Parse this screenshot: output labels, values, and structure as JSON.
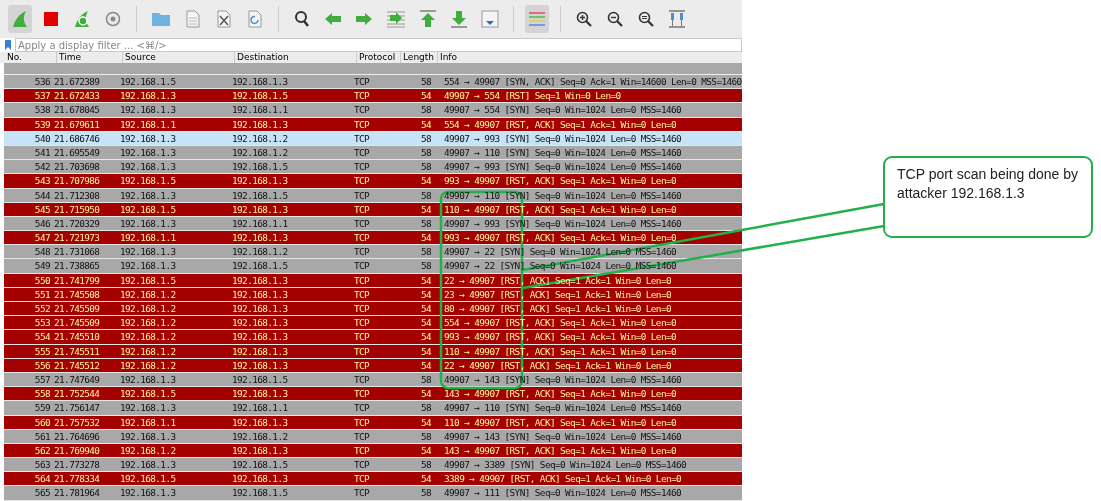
{
  "filter_bar": {
    "placeholder": "Apply a display filter ... <⌘/>"
  },
  "columns": [
    "No.",
    "Time",
    "Source",
    "Destination",
    "Protocol",
    "Length",
    "Info"
  ],
  "rows": [
    {
      "kind": "syn",
      "selected": false,
      "cells": [
        "536",
        "21.672389",
        "192.168.1.5",
        "192.168.1.3",
        "TCP",
        "58",
        "554 → 49907 [SYN, ACK] Seq=0 Ack=1 Win=14600 Len=0 MSS=1460"
      ]
    },
    {
      "kind": "rst",
      "selected": false,
      "cells": [
        "537",
        "21.672433",
        "192.168.1.3",
        "192.168.1.5",
        "TCP",
        "54",
        "49907 → 554 [RST] Seq=1 Win=0 Len=0"
      ]
    },
    {
      "kind": "syn",
      "selected": false,
      "cells": [
        "538",
        "21.678045",
        "192.168.1.3",
        "192.168.1.1",
        "TCP",
        "58",
        "49907 → 554 [SYN] Seq=0 Win=1024 Len=0 MSS=1460"
      ]
    },
    {
      "kind": "rst",
      "selected": false,
      "cells": [
        "539",
        "21.679611",
        "192.168.1.1",
        "192.168.1.3",
        "TCP",
        "54",
        "554 → 49907 [RST, ACK] Seq=1 Ack=1 Win=0 Len=0"
      ]
    },
    {
      "kind": "syn",
      "selected": true,
      "cells": [
        "540",
        "21.686746",
        "192.168.1.3",
        "192.168.1.2",
        "TCP",
        "58",
        "49907 → 993 [SYN] Seq=0 Win=1024 Len=0 MSS=1460"
      ]
    },
    {
      "kind": "syn",
      "selected": false,
      "cells": [
        "541",
        "21.695549",
        "192.168.1.3",
        "192.168.1.2",
        "TCP",
        "58",
        "49907 → 110 [SYN] Seq=0 Win=1024 Len=0 MSS=1460"
      ]
    },
    {
      "kind": "syn",
      "selected": false,
      "cells": [
        "542",
        "21.703698",
        "192.168.1.3",
        "192.168.1.5",
        "TCP",
        "58",
        "49907 → 993 [SYN] Seq=0 Win=1024 Len=0 MSS=1460"
      ]
    },
    {
      "kind": "rst",
      "selected": false,
      "cells": [
        "543",
        "21.707986",
        "192.168.1.5",
        "192.168.1.3",
        "TCP",
        "54",
        "993 → 49907 [RST, ACK] Seq=1 Ack=1 Win=0 Len=0"
      ]
    },
    {
      "kind": "syn",
      "selected": false,
      "cells": [
        "544",
        "21.712308",
        "192.168.1.3",
        "192.168.1.5",
        "TCP",
        "58",
        "49907 → 110 [SYN] Seq=0 Win=1024 Len=0 MSS=1460"
      ]
    },
    {
      "kind": "rst",
      "selected": false,
      "cells": [
        "545",
        "21.715950",
        "192.168.1.5",
        "192.168.1.3",
        "TCP",
        "54",
        "110 → 49907 [RST, ACK] Seq=1 Ack=1 Win=0 Len=0"
      ]
    },
    {
      "kind": "syn",
      "selected": false,
      "cells": [
        "546",
        "21.720329",
        "192.168.1.3",
        "192.168.1.1",
        "TCP",
        "58",
        "49907 → 993 [SYN] Seq=0 Win=1024 Len=0 MSS=1460"
      ]
    },
    {
      "kind": "rst",
      "selected": false,
      "cells": [
        "547",
        "21.721973",
        "192.168.1.1",
        "192.168.1.3",
        "TCP",
        "54",
        "993 → 49907 [RST, ACK] Seq=1 Ack=1 Win=0 Len=0"
      ]
    },
    {
      "kind": "syn",
      "selected": false,
      "cells": [
        "548",
        "21.731068",
        "192.168.1.3",
        "192.168.1.2",
        "TCP",
        "58",
        "49907 → 22 [SYN] Seq=0 Win=1024 Len=0 MSS=1460"
      ]
    },
    {
      "kind": "syn",
      "selected": false,
      "cells": [
        "549",
        "21.738865",
        "192.168.1.3",
        "192.168.1.5",
        "TCP",
        "58",
        "49907 → 22 [SYN] Seq=0 Win=1024 Len=0 MSS=1460"
      ]
    },
    {
      "kind": "rst",
      "selected": false,
      "cells": [
        "550",
        "21.741799",
        "192.168.1.5",
        "192.168.1.3",
        "TCP",
        "54",
        "22 → 49907 [RST, ACK] Seq=1 Ack=1 Win=0 Len=0"
      ]
    },
    {
      "kind": "rst",
      "selected": false,
      "cells": [
        "551",
        "21.745508",
        "192.168.1.2",
        "192.168.1.3",
        "TCP",
        "54",
        "23 → 49907 [RST, ACK] Seq=1 Ack=1 Win=0 Len=0"
      ]
    },
    {
      "kind": "rst",
      "selected": false,
      "cells": [
        "552",
        "21.745509",
        "192.168.1.2",
        "192.168.1.3",
        "TCP",
        "54",
        "80 → 49907 [RST, ACK] Seq=1 Ack=1 Win=0 Len=0"
      ]
    },
    {
      "kind": "rst",
      "selected": false,
      "cells": [
        "553",
        "21.745509",
        "192.168.1.2",
        "192.168.1.3",
        "TCP",
        "54",
        "554 → 49907 [RST, ACK] Seq=1 Ack=1 Win=0 Len=0"
      ]
    },
    {
      "kind": "rst",
      "selected": false,
      "cells": [
        "554",
        "21.745510",
        "192.168.1.2",
        "192.168.1.3",
        "TCP",
        "54",
        "993 → 49907 [RST, ACK] Seq=1 Ack=1 Win=0 Len=0"
      ]
    },
    {
      "kind": "rst",
      "selected": false,
      "cells": [
        "555",
        "21.745511",
        "192.168.1.2",
        "192.168.1.3",
        "TCP",
        "54",
        "110 → 49907 [RST, ACK] Seq=1 Ack=1 Win=0 Len=0"
      ]
    },
    {
      "kind": "rst",
      "selected": false,
      "cells": [
        "556",
        "21.745512",
        "192.168.1.2",
        "192.168.1.3",
        "TCP",
        "54",
        "22 → 49907 [RST, ACK] Seq=1 Ack=1 Win=0 Len=0"
      ]
    },
    {
      "kind": "syn",
      "selected": false,
      "cells": [
        "557",
        "21.747649",
        "192.168.1.3",
        "192.168.1.5",
        "TCP",
        "58",
        "49907 → 143 [SYN] Seq=0 Win=1024 Len=0 MSS=1460"
      ]
    },
    {
      "kind": "rst",
      "selected": false,
      "cells": [
        "558",
        "21.752544",
        "192.168.1.5",
        "192.168.1.3",
        "TCP",
        "54",
        "143 → 49907 [RST, ACK] Seq=1 Ack=1 Win=0 Len=0"
      ]
    },
    {
      "kind": "syn",
      "selected": false,
      "cells": [
        "559",
        "21.756147",
        "192.168.1.3",
        "192.168.1.1",
        "TCP",
        "58",
        "49907 → 110 [SYN] Seq=0 Win=1024 Len=0 MSS=1460"
      ]
    },
    {
      "kind": "rst",
      "selected": false,
      "cells": [
        "560",
        "21.757532",
        "192.168.1.1",
        "192.168.1.3",
        "TCP",
        "54",
        "110 → 49907 [RST, ACK] Seq=1 Ack=1 Win=0 Len=0"
      ]
    },
    {
      "kind": "syn",
      "selected": false,
      "cells": [
        "561",
        "21.764696",
        "192.168.1.3",
        "192.168.1.2",
        "TCP",
        "58",
        "49907 → 143 [SYN] Seq=0 Win=1024 Len=0 MSS=1460"
      ]
    },
    {
      "kind": "rst",
      "selected": false,
      "cells": [
        "562",
        "21.769940",
        "192.168.1.2",
        "192.168.1.3",
        "TCP",
        "54",
        "143 → 49907 [RST, ACK] Seq=1 Ack=1 Win=0 Len=0"
      ]
    },
    {
      "kind": "syn",
      "selected": false,
      "cells": [
        "563",
        "21.773278",
        "192.168.1.3",
        "192.168.1.5",
        "TCP",
        "58",
        "49907 → 3389 [SYN] Seq=0 Win=1024 Len=0 MSS=1460"
      ]
    },
    {
      "kind": "rst",
      "selected": false,
      "cells": [
        "564",
        "21.778334",
        "192.168.1.5",
        "192.168.1.3",
        "TCP",
        "54",
        "3389 → 49907 [RST, ACK] Seq=1 Ack=1 Win=0 Len=0"
      ]
    },
    {
      "kind": "syn",
      "selected": false,
      "cells": [
        "565",
        "21.781964",
        "192.168.1.3",
        "192.168.1.5",
        "TCP",
        "58",
        "49907 → 111 [SYN] Seq=0 Win=1024 Len=0 MSS=1460"
      ]
    }
  ],
  "callout": {
    "text": "TCP port scan being done by attacker 192.168.1.3"
  }
}
